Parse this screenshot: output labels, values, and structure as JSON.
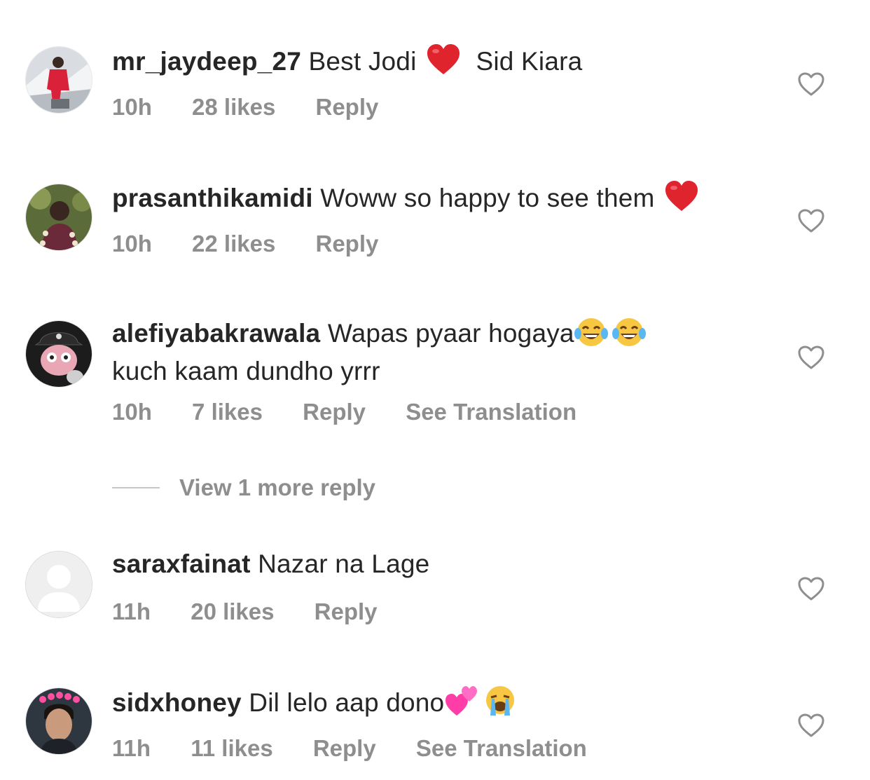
{
  "comments": [
    {
      "username": "mr_jaydeep_27",
      "text_before": "Best Jodi",
      "text_after": "Sid Kiara",
      "time": "10h",
      "likes": "28 likes",
      "reply": "Reply",
      "avatar_icon": "person-in-red-snow-photo",
      "emoji": [
        "red-heart"
      ]
    },
    {
      "username": "prasanthikamidi",
      "text_before": "Woww so happy to see them",
      "text_after": "",
      "time": "10h",
      "likes": "22 likes",
      "reply": "Reply",
      "avatar_icon": "woman-portrait-photo",
      "emoji": [
        "red-heart"
      ]
    },
    {
      "username": "alefiyabakrawala",
      "text_before": "Wapas pyaar hogaya",
      "text_line2": "kuch kaam dundho yrrr",
      "time": "10h",
      "likes": "7 likes",
      "reply": "Reply",
      "translate": "See Translation",
      "avatar_icon": "cartoon-creature-avatar",
      "emoji": [
        "tears-of-joy",
        "tears-of-joy"
      ]
    },
    {
      "username": "saraxfainat",
      "text_before": "Nazar na Lage",
      "time": "11h",
      "likes": "20 likes",
      "reply": "Reply",
      "avatar_icon": "default-user-avatar"
    },
    {
      "username": "sidxhoney",
      "text_before": "Dil lelo aap dono",
      "time": "11h",
      "likes": "11 likes",
      "reply": "Reply",
      "translate": "See Translation",
      "avatar_icon": "man-with-heart-crown-photo",
      "emoji": [
        "two-hearts",
        "loudly-crying"
      ]
    }
  ],
  "view_more_replies": "View 1 more reply",
  "colors": {
    "text": "#262626",
    "secondary": "#8e8e8e",
    "heart_red": "#e0242e",
    "emoji_yellow": "#f7c744"
  }
}
